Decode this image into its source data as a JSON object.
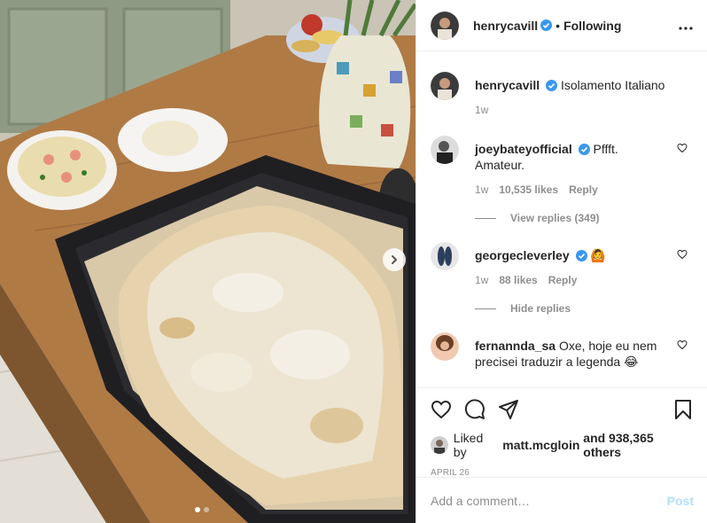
{
  "post": {
    "author": "henrycavill",
    "follow_sep": "•",
    "follow_status": "Following",
    "caption": "Isolamento Italiano",
    "caption_time": "1w",
    "liked_by_prefix": "Liked by",
    "liked_by_user": "matt.mcgloin",
    "liked_by_suffix": "and 938,365 others",
    "date": "April 26"
  },
  "comments": [
    {
      "user": "joeybateyofficial",
      "text": "Pffft. Amateur.",
      "time": "1w",
      "likes": "10,535 likes",
      "reply": "Reply",
      "replies_toggle": "View replies (349)"
    },
    {
      "user": "georgecleverley",
      "text": "🙆",
      "time": "1w",
      "likes": "88 likes",
      "reply": "Reply",
      "replies_toggle": "Hide replies"
    },
    {
      "user": "fernannda_sa",
      "text": "Oxe, hoje eu nem precisei traduzir a legenda 😂"
    }
  ],
  "composer": {
    "placeholder": "Add a comment…",
    "post_label": "Post"
  },
  "carousel": {
    "slide": 1,
    "slides": 2
  },
  "colors": {
    "verified": "#3897f0",
    "post_disabled": "#b2dffc",
    "muted": "#8e8e8e"
  },
  "icons": [
    "more-options-icon",
    "heart-icon",
    "comment-icon",
    "share-icon",
    "bookmark-icon",
    "verified-badge-icon",
    "next-arrow-icon"
  ]
}
